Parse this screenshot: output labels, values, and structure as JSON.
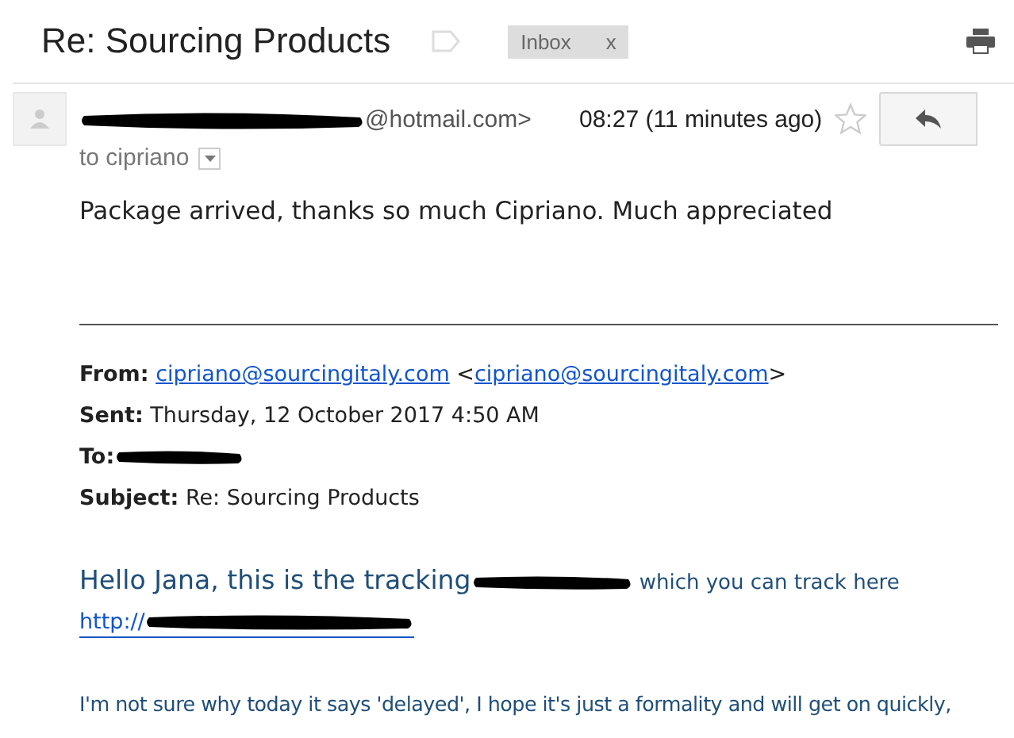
{
  "thread": {
    "subject": "Re: Sourcing Products",
    "label_chip": {
      "text": "Inbox",
      "close": "x"
    }
  },
  "message": {
    "sender_visible": "@hotmail.com>",
    "sender_redacted": true,
    "time": "08:27 (11 minutes ago)",
    "starred": false,
    "recipient": "to cipriano",
    "body": "Package arrived, thanks so much Cipriano. Much appreciated",
    "quoted": {
      "from_label": "From:",
      "from_link": "cipriano@sourcingitaly.com",
      "from_open": "<",
      "from_link_2": "cipriano@sourcingitaly.com",
      "from_close": ">",
      "sent_label": "Sent:",
      "sent": "Thursday, 12 October 2017 4:50 AM",
      "to_label": "To:",
      "to_redacted": true,
      "subject_label": "Subject:",
      "subject": "Re: Sourcing Products",
      "greeting": "Hello Jana, this is the tracking",
      "tracking_redacted": true,
      "greeting_end": "which you can track here",
      "link": "http://",
      "link_redacted": true,
      "paragraph": "I'm not sure why today it says 'delayed', I hope it's just a formality and will get on quickly,"
    }
  }
}
